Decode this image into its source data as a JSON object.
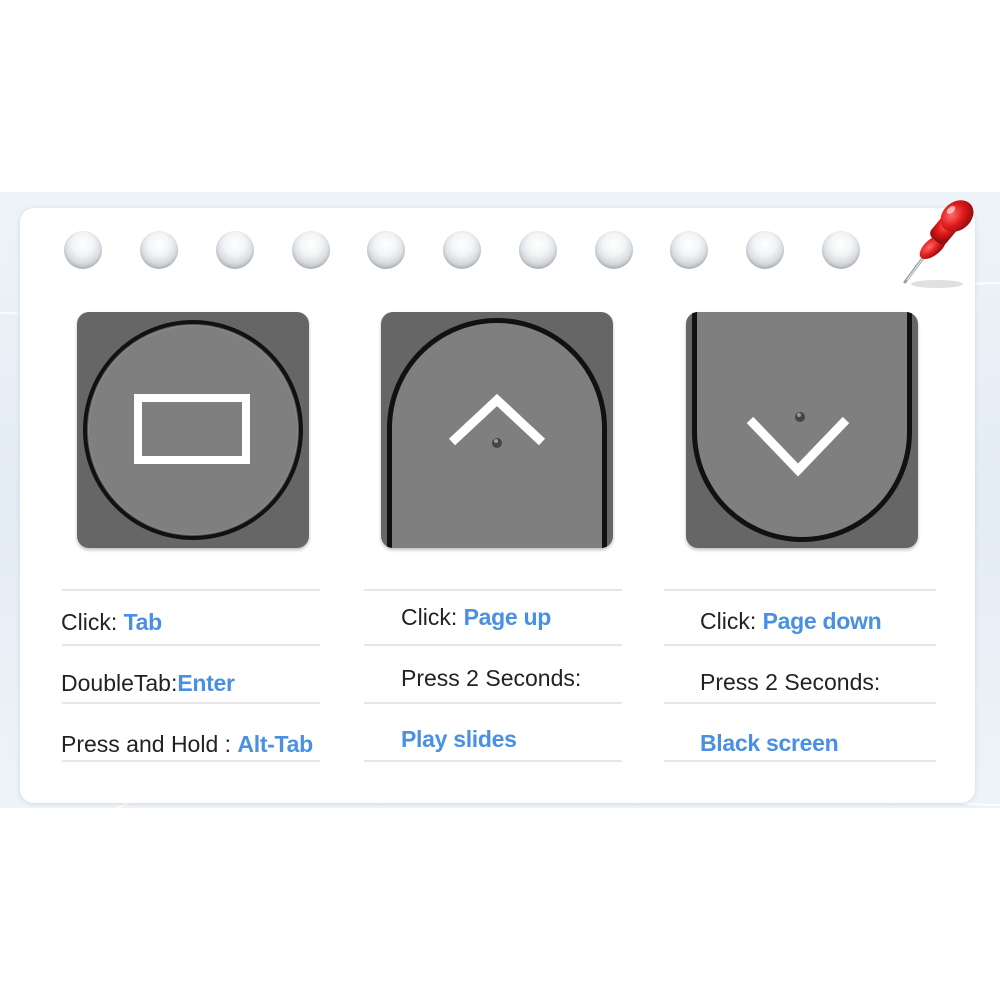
{
  "colors": {
    "accent": "#4a90e2",
    "key_face": "#7f7f7f",
    "key_base": "#666666",
    "text": "#222222"
  },
  "decoration": {
    "hole_count": 11,
    "pin_icon": "push-pin-icon"
  },
  "keys": [
    {
      "icon": "rectangle-icon",
      "rows": [
        {
          "label": "Click: ",
          "value": "Tab"
        },
        {
          "label": "DoubleTab:",
          "value": "Enter"
        },
        {
          "label": "Press and Hold : ",
          "value": "Alt-Tab"
        }
      ]
    },
    {
      "icon": "chevron-up-icon",
      "rows": [
        {
          "label": "Click: ",
          "value": "Page up"
        },
        {
          "label": "Press 2 Seconds:",
          "value": ""
        },
        {
          "label": "",
          "value": "Play slides"
        }
      ]
    },
    {
      "icon": "chevron-down-icon",
      "rows": [
        {
          "label": "Click: ",
          "value": "Page down"
        },
        {
          "label": "Press 2 Seconds:",
          "value": ""
        },
        {
          "label": "",
          "value": "Black screen"
        }
      ]
    }
  ]
}
